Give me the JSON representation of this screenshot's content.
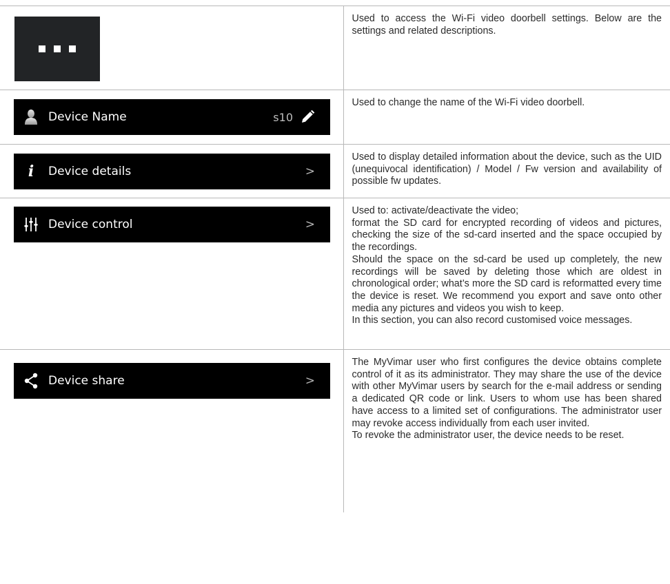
{
  "rows": [
    {
      "bar": {
        "kind": "menu-tile",
        "icon": "more-icon"
      },
      "description": [
        "Used to access the Wi-Fi video doorbell settings. Below are the settings and related descriptions."
      ]
    },
    {
      "bar": {
        "label": "Device Name",
        "value": "s10",
        "icon": "user-icon",
        "action_icon": "pencil-icon"
      },
      "description": [
        "Used to change the name of the Wi-Fi video doorbell."
      ]
    },
    {
      "bar": {
        "label": "Device details",
        "icon": "info-icon",
        "chevron": ">"
      },
      "description": [
        "Used to display detailed information about the device, such as the UID (unequivocal identification) / Model / Fw version and availability of possible fw updates."
      ]
    },
    {
      "bar": {
        "label": "Device control",
        "icon": "sliders-icon",
        "chevron": ">"
      },
      "description": [
        "Used to: activate/deactivate the video;",
        "format the SD card for encrypted recording of videos and pictures, checking the size of the sd-card inserted and the space occupied by the recordings.",
        "Should the space on the sd-card be used up completely, the new recordings will be saved by deleting those which are oldest in chronological order; what’s more the SD card is reformatted every time the device is reset. We recommend you export and save onto other media any pictures and videos you wish to keep.",
        "In this section, you can also record customised voice messages."
      ]
    },
    {
      "bar": {
        "label": "Device share",
        "icon": "share-icon",
        "chevron": ">"
      },
      "description": [
        "The MyVimar user who first configures the device obtains complete control of it as its administrator. They may share the use of the device with other MyVimar users by search for the e-mail address or sending a dedicated QR code or link. Users to whom use has been shared have access to a limited set of configurations. The administrator user may revoke access individually from each user invited.",
        "To revoke the administrator user, the device needs to be reset."
      ]
    }
  ],
  "colors": {
    "bar_background": "#000000",
    "tile_background": "#222426",
    "table_border": "#b8b8b8",
    "body_text": "#2b2b2b"
  }
}
